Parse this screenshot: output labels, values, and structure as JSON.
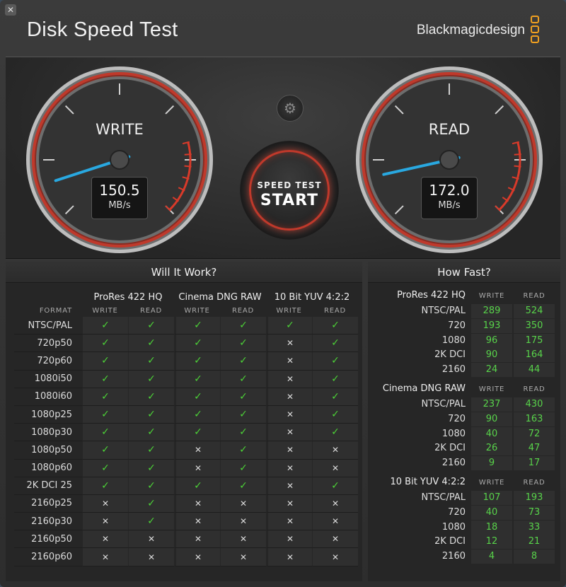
{
  "window": {
    "close_label": "✕",
    "title": "Disk Speed Test",
    "brand": "Blackmagicdesign"
  },
  "gauges": {
    "write": {
      "label": "WRITE",
      "value": "150.5",
      "unit": "MB/s",
      "needle_fraction": 0.1
    },
    "read": {
      "label": "READ",
      "value": "172.0",
      "unit": "MB/s",
      "needle_fraction": 0.12
    }
  },
  "start_button": {
    "top_label": "SPEED TEST",
    "main_label": "START"
  },
  "settings_icon": "gear-icon",
  "will_it_work": {
    "title": "Will It Work?",
    "format_header": "FORMAT",
    "groups": [
      "ProRes 422 HQ",
      "Cinema DNG RAW",
      "10 Bit YUV 4:2:2"
    ],
    "sub_headers": [
      "WRITE",
      "READ",
      "WRITE",
      "READ",
      "WRITE",
      "READ"
    ],
    "rows": [
      {
        "format": "NTSC/PAL",
        "cells": [
          1,
          1,
          1,
          1,
          1,
          1
        ]
      },
      {
        "format": "720p50",
        "cells": [
          1,
          1,
          1,
          1,
          0,
          1
        ]
      },
      {
        "format": "720p60",
        "cells": [
          1,
          1,
          1,
          1,
          0,
          1
        ]
      },
      {
        "format": "1080i50",
        "cells": [
          1,
          1,
          1,
          1,
          0,
          1
        ]
      },
      {
        "format": "1080i60",
        "cells": [
          1,
          1,
          1,
          1,
          0,
          1
        ]
      },
      {
        "format": "1080p25",
        "cells": [
          1,
          1,
          1,
          1,
          0,
          1
        ]
      },
      {
        "format": "1080p30",
        "cells": [
          1,
          1,
          1,
          1,
          0,
          1
        ]
      },
      {
        "format": "1080p50",
        "cells": [
          1,
          1,
          0,
          1,
          0,
          0
        ]
      },
      {
        "format": "1080p60",
        "cells": [
          1,
          1,
          0,
          1,
          0,
          0
        ]
      },
      {
        "format": "2K DCI 25",
        "cells": [
          1,
          1,
          1,
          1,
          0,
          1
        ]
      },
      {
        "format": "2160p25",
        "cells": [
          0,
          1,
          0,
          0,
          0,
          0
        ]
      },
      {
        "format": "2160p30",
        "cells": [
          0,
          1,
          0,
          0,
          0,
          0
        ]
      },
      {
        "format": "2160p50",
        "cells": [
          0,
          0,
          0,
          0,
          0,
          0
        ]
      },
      {
        "format": "2160p60",
        "cells": [
          0,
          0,
          0,
          0,
          0,
          0
        ]
      }
    ],
    "check_glyph": "✓",
    "cross_glyph": "✕"
  },
  "how_fast": {
    "title": "How Fast?",
    "write_header": "WRITE",
    "read_header": "READ",
    "blocks": [
      {
        "name": "ProRes 422 HQ",
        "rows": [
          {
            "label": "NTSC/PAL",
            "write": "289",
            "read": "524"
          },
          {
            "label": "720",
            "write": "193",
            "read": "350"
          },
          {
            "label": "1080",
            "write": "96",
            "read": "175"
          },
          {
            "label": "2K DCI",
            "write": "90",
            "read": "164"
          },
          {
            "label": "2160",
            "write": "24",
            "read": "44"
          }
        ]
      },
      {
        "name": "Cinema DNG RAW",
        "rows": [
          {
            "label": "NTSC/PAL",
            "write": "237",
            "read": "430"
          },
          {
            "label": "720",
            "write": "90",
            "read": "163"
          },
          {
            "label": "1080",
            "write": "40",
            "read": "72"
          },
          {
            "label": "2K DCI",
            "write": "26",
            "read": "47"
          },
          {
            "label": "2160",
            "write": "9",
            "read": "17"
          }
        ]
      },
      {
        "name": "10 Bit YUV 4:2:2",
        "rows": [
          {
            "label": "NTSC/PAL",
            "write": "107",
            "read": "193"
          },
          {
            "label": "720",
            "write": "40",
            "read": "73"
          },
          {
            "label": "1080",
            "write": "18",
            "read": "33"
          },
          {
            "label": "2K DCI",
            "write": "12",
            "read": "21"
          },
          {
            "label": "2160",
            "write": "4",
            "read": "8"
          }
        ]
      }
    ]
  },
  "colors": {
    "check": "#4cd137",
    "number": "#58d34a",
    "needle": "#29a8e0",
    "redline": "#d83a2a",
    "accent": "#f0a020"
  }
}
